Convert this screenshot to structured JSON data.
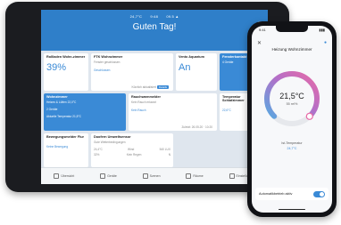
{
  "tablet": {
    "status": {
      "temp": "24,7°C",
      "time": "9:48",
      "date": "09.5 ▲"
    },
    "greeting": "Guten Tag!",
    "cards": {
      "c1": {
        "title": "Rollladen Wohn-zimmer",
        "value": "39%"
      },
      "c2": {
        "title": "FTK Wohnzimmer",
        "sub": "Fenster geschlossen",
        "state": "Geschlossen",
        "foot": "Kürzlich aktualisiert",
        "btn": "Details"
      },
      "c3": {
        "title": "Vento Aquarium",
        "value": "An"
      },
      "c4": {
        "title": "Fensterkontakt",
        "sub": "4 Geräte"
      },
      "c5": {
        "title": "Wohnzimmer",
        "sub": "Heizen & Lüften 22,0°C",
        "line": "2 Geräte",
        "line2": "Aktuelle Temperatur 21,5°C"
      },
      "c6": {
        "title": "Rauchwarnmelder",
        "sub": "Kein Rauch erkannt",
        "state": "Kein Rauch",
        "foot": "Zuletzt: 26.05.20 · 10:20"
      },
      "c7": {
        "title": "Temperatur Schlafzimmer",
        "value": "22,6°C"
      },
      "c8": {
        "title": "Bewegungsmelder Flur",
        "state": "Keine Bewegung"
      },
      "c9": {
        "title": "Duofern Umweltsensor",
        "sub": "Gute Wetterbedingungen",
        "r1a": "24,4°C",
        "r1b": "Wind",
        "r1c": "540 LUX",
        "r2a": "32%",
        "r2b": "Kein Regen",
        "r2c": "N"
      }
    },
    "nav": [
      "Übersicht",
      "Geräte",
      "Szenen",
      "Räume",
      "Einstellungen"
    ]
  },
  "phone": {
    "time": "9:41",
    "title": "Heizung Wohnzimmer",
    "temp": "21,5°C",
    "humidity": "55 rel%",
    "stell_label": "Ist-Temperatur",
    "stell_value": "24,7°C",
    "auto_label": "Automatikbetrieb aktiv",
    "gauge_color": "#e86aa6"
  }
}
